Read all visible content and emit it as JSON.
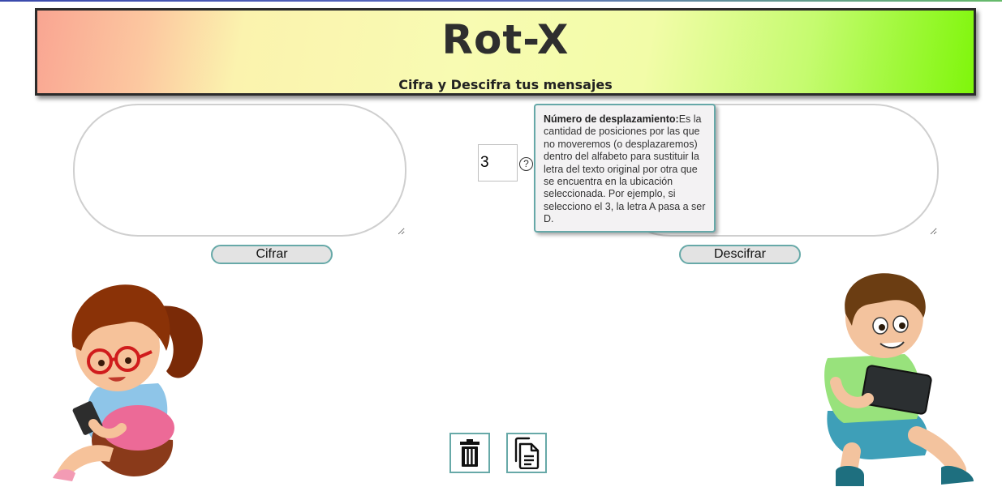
{
  "header": {
    "title": "Rot-X",
    "subtitle": "Cifra y Descifra tus mensajes"
  },
  "input_text": {
    "value": "",
    "placeholder": ""
  },
  "output_text": {
    "value": "",
    "placeholder": ""
  },
  "shift": {
    "value": "3",
    "help_symbol": "?"
  },
  "tooltip": {
    "heading": "Número de desplazamiento:",
    "body": "Es la cantidad de posiciones por las que no moveremos (o desplazaremos) dentro del alfabeto para sustituir la letra del texto original por otra que se encuentra en la ubicación seleccionada. Por ejemplo, si selecciono el 3, la letra A pasa a ser D."
  },
  "buttons": {
    "cipher": "Cifrar",
    "decipher": "Descifrar",
    "clear_icon": "trash-icon",
    "copy_icon": "copy-icon"
  },
  "illustrations": {
    "left": "girl-with-phone",
    "right": "boy-with-tablet"
  },
  "colors": {
    "accent_border": "#67a9a8",
    "button_bg": "#e3e3e3",
    "header_start": "#f9a592",
    "header_end": "#7ff60b"
  }
}
